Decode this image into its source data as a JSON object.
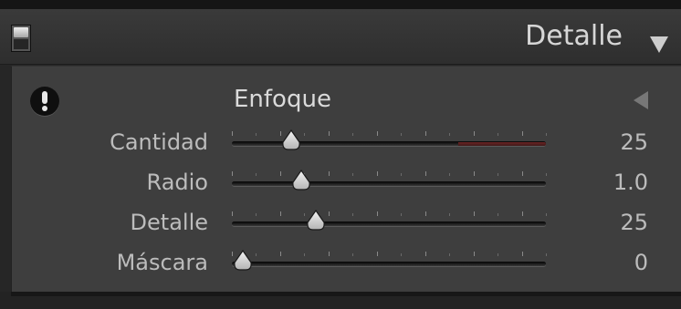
{
  "header": {
    "title": "Detalle",
    "solo_icon": "panel-solo-toggle-icon",
    "collapse_icon": "triangle-down-icon"
  },
  "section": {
    "title": "Enfoque",
    "warning_icon": "exclamation-circle-icon",
    "collapse_icon": "triangle-left-icon"
  },
  "sliders": [
    {
      "label": "Cantidad",
      "value": "25",
      "min": 0,
      "max": 150,
      "numeric": 25
    },
    {
      "label": "Radio",
      "value": "1.0",
      "min": 0.5,
      "max": 3.0,
      "numeric": 1.0
    },
    {
      "label": "Detalle",
      "value": "25",
      "min": 0,
      "max": 100,
      "numeric": 25
    },
    {
      "label": "Máscara",
      "value": "0",
      "min": 0,
      "max": 100,
      "numeric": 0
    }
  ],
  "colors": {
    "panel_bg": "#3e3e3e",
    "header_bg": "#333333",
    "text": "#bcbcbc",
    "track_warning": "#6b2424"
  }
}
